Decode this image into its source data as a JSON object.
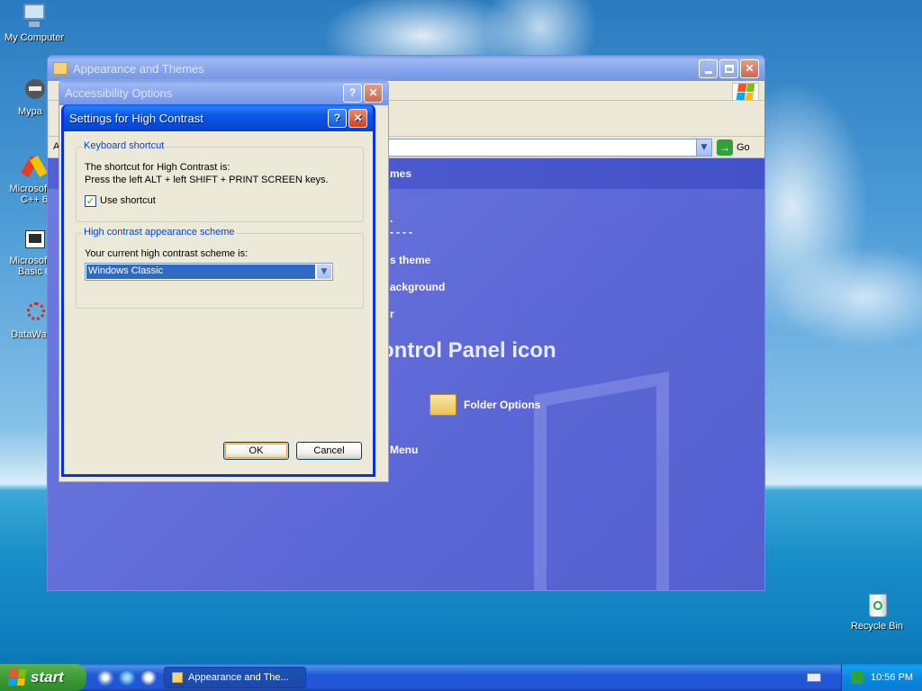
{
  "desktop": {
    "icons": [
      {
        "label": "My Computer"
      },
      {
        "label": "Mypa"
      },
      {
        "label": "Microsoft V C++ 6"
      },
      {
        "label": "Microsoft V Basic 6"
      },
      {
        "label": "DataWago"
      },
      {
        "label": "Recycle Bin"
      }
    ]
  },
  "control_panel": {
    "title": "Appearance and Themes",
    "address_prefix": "A",
    "go_label": "Go",
    "section_heading_partial": "mes",
    "tasks": [
      "s theme",
      "ackground",
      "r"
    ],
    "pick_heading_partial": "ontrol Panel icon",
    "icons": [
      "Folder Options"
    ],
    "extra_partial": "Menu"
  },
  "accessibility": {
    "title": "Accessibility Options"
  },
  "high_contrast": {
    "title": "Settings for High Contrast",
    "keyboard_group": "Keyboard shortcut",
    "shortcut_line1": "The shortcut for High Contrast is:",
    "shortcut_line2": "Press the left ALT + left SHIFT + PRINT SCREEN keys.",
    "use_shortcut_label": "Use shortcut",
    "use_shortcut_checked": true,
    "scheme_group": "High contrast appearance scheme",
    "scheme_label": "Your current high contrast scheme is:",
    "scheme_value": "Windows Classic",
    "ok_label": "OK",
    "cancel_label": "Cancel"
  },
  "taskbar": {
    "start_label": "start",
    "window_button": "Appearance and The...",
    "clock": "10:56 PM"
  },
  "colors": {
    "title_active": "#0a58e6",
    "group_legend": "#0046d5",
    "selection": "#316ac5"
  }
}
